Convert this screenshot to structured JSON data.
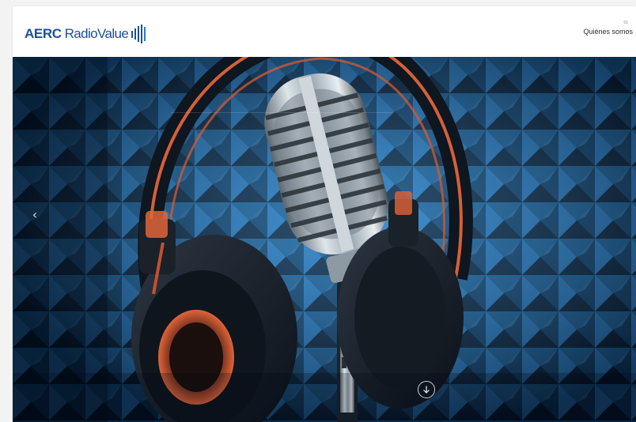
{
  "header": {
    "logo": {
      "bold_text": "AERC",
      "light_text": "RadioValue",
      "icon": "sound-bars-icon",
      "color": "#1d4f9c"
    },
    "nav": {
      "number": "01",
      "label": "Quiénes somos"
    }
  },
  "hero": {
    "image": "studio-microphone-with-headphones",
    "prev_icon": "chevron-left-icon",
    "prev_glyph": "‹",
    "scroll_icon": "arrow-down-circle-icon",
    "colors": {
      "foam": "#14466f",
      "foam_highlight": "#3d9ad6",
      "headphone_accent": "#e0643a",
      "mic_chrome": "#b8c4cc"
    }
  }
}
